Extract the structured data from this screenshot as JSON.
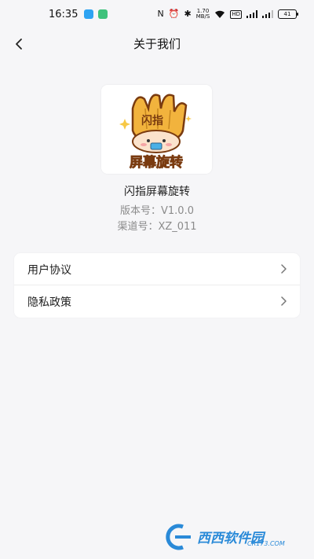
{
  "status_bar": {
    "time": "16:35",
    "net_speed_value": "1.70",
    "net_speed_unit": "MB/S",
    "hd_label": "HD",
    "battery_level": "41",
    "app_icon_colors": [
      "#2ea3f2",
      "#3fc27c"
    ]
  },
  "header": {
    "title": "关于我们"
  },
  "app_info": {
    "logo_text_top": "闪指",
    "logo_text_bottom": "屏幕旋转",
    "name": "闪指屏幕旋转",
    "version": "版本号：V1.0.0",
    "channel": "渠道号：XZ_011"
  },
  "menu": {
    "items": [
      {
        "label": "用户协议",
        "icon": "chevron-right-icon"
      },
      {
        "label": "隐私政策",
        "icon": "chevron-right-icon"
      }
    ]
  },
  "watermark": {
    "brand": "西西软件园",
    "site": "CR173.COM"
  },
  "colors": {
    "background": "#f6f6f8",
    "card": "#ffffff",
    "text_primary": "#222222",
    "text_secondary": "#8b8b8b",
    "logo_gold": "#f2b33d",
    "logo_brown": "#7a3b10"
  }
}
